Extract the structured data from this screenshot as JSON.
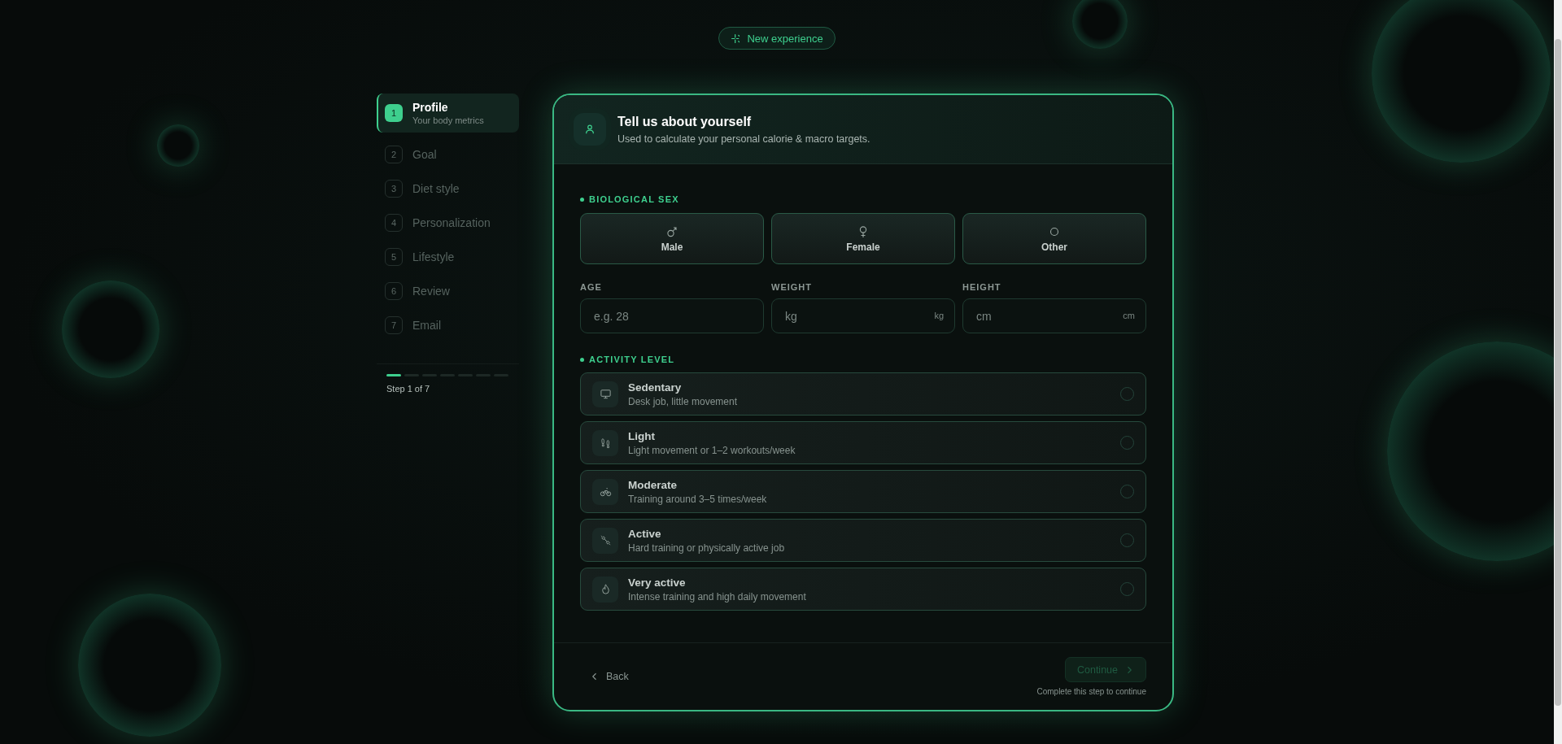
{
  "badge": {
    "label": "New experience"
  },
  "steps": [
    {
      "number": "1",
      "title": "Profile",
      "subtitle": "Your body metrics",
      "selected": true
    },
    {
      "number": "2",
      "title": "Goal",
      "selected": false
    },
    {
      "number": "3",
      "title": "Diet style",
      "selected": false
    },
    {
      "number": "4",
      "title": "Personalization",
      "selected": false
    },
    {
      "number": "5",
      "title": "Lifestyle",
      "selected": false
    },
    {
      "number": "6",
      "title": "Review",
      "selected": false
    },
    {
      "number": "7",
      "title": "Email",
      "selected": false
    }
  ],
  "progress": {
    "segments": [
      {
        "done": true
      },
      {
        "done": false
      },
      {
        "done": false
      },
      {
        "done": false
      },
      {
        "done": false
      },
      {
        "done": false
      },
      {
        "done": false
      }
    ],
    "label": "Step 1 of 7"
  },
  "card": {
    "title": "Tell us about yourself",
    "subtitle": "Used to calculate your personal calorie & macro targets.",
    "sex": {
      "label": "BIOLOGICAL SEX",
      "options": [
        {
          "kind": "male",
          "label": "Male",
          "selected": false
        },
        {
          "kind": "female",
          "label": "Female",
          "selected": false
        },
        {
          "kind": "other",
          "label": "Other",
          "selected": false
        }
      ]
    },
    "fields": [
      {
        "label": "AGE",
        "placeholder": "e.g. 28"
      },
      {
        "label": "WEIGHT",
        "placeholder": "kg",
        "unit": "kg"
      },
      {
        "label": "HEIGHT",
        "placeholder": "cm",
        "unit": "cm"
      }
    ],
    "activity": {
      "label": "ACTIVITY LEVEL",
      "options": [
        {
          "kind": "sedentary",
          "title": "Sedentary",
          "description": "Desk job, little movement",
          "selected": false
        },
        {
          "kind": "light",
          "title": "Light",
          "description": "Light movement or 1–2 workouts/week",
          "selected": false
        },
        {
          "kind": "moderate",
          "title": "Moderate",
          "description": "Training around 3–5 times/week",
          "selected": false
        },
        {
          "kind": "active",
          "title": "Active",
          "description": "Hard training or physically active job",
          "selected": false
        },
        {
          "kind": "very_active",
          "title": "Very active",
          "description": "Intense training and high daily movement",
          "selected": false
        }
      ]
    },
    "footer": {
      "back": "Back",
      "continue": {
        "label": "Continue",
        "disabled": true
      },
      "hint": "Complete this step to continue"
    }
  }
}
